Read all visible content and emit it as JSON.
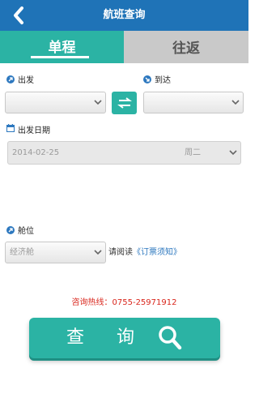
{
  "header": {
    "title": "航班查询",
    "back_icon": "chevron-left-icon"
  },
  "tabs": [
    {
      "label": "单程",
      "active": true
    },
    {
      "label": "往返",
      "active": false
    }
  ],
  "departure": {
    "label": "出发",
    "value": ""
  },
  "arrival": {
    "label": "到达",
    "value": ""
  },
  "swap": {
    "icon": "swap-icon"
  },
  "date": {
    "label": "出发日期",
    "value": "2014-02-25",
    "weekday": "周二"
  },
  "cabin": {
    "label": "舱位",
    "value": "经济舱"
  },
  "notice": {
    "prefix": "请阅读",
    "link": "《订票须知》"
  },
  "hotline": "咨询热线：0755-25971912",
  "query_button": {
    "label": "查询",
    "icon": "search-icon"
  },
  "colors": {
    "header": "#1f73b7",
    "accent": "#2bb3a4",
    "tab_inactive": "#c9c9c9",
    "hotline": "#d9261c",
    "link": "#2d78bf"
  }
}
